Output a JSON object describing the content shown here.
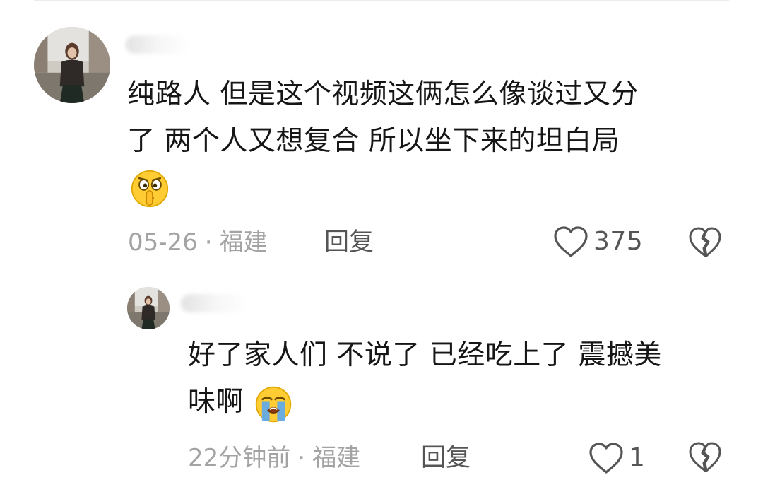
{
  "comment": {
    "username": "",
    "text_line1": "纯路人 但是这个视频这俩怎么像谈过又分",
    "text_line2": "了 两个人又想复合 所以坐下来的坦白局",
    "emoji": "shushing-face",
    "date": "05-26",
    "separator": "·",
    "location": "福建",
    "reply_label": "回复",
    "like_count": "375"
  },
  "reply": {
    "username": "",
    "text_line1": "好了家人们 不说了 已经吃上了 震撼美",
    "text_line2": "味啊",
    "emoji": "loudly-crying-face",
    "date": "22分钟前",
    "separator": "·",
    "location": "福建",
    "reply_label": "回复",
    "like_count": "1"
  },
  "icons": {
    "like": "heart-outline-icon",
    "dislike": "broken-heart-outline-icon"
  },
  "colors": {
    "text": "#161616",
    "meta": "#a3a3a3",
    "action": "#555555",
    "background": "#ffffff"
  }
}
